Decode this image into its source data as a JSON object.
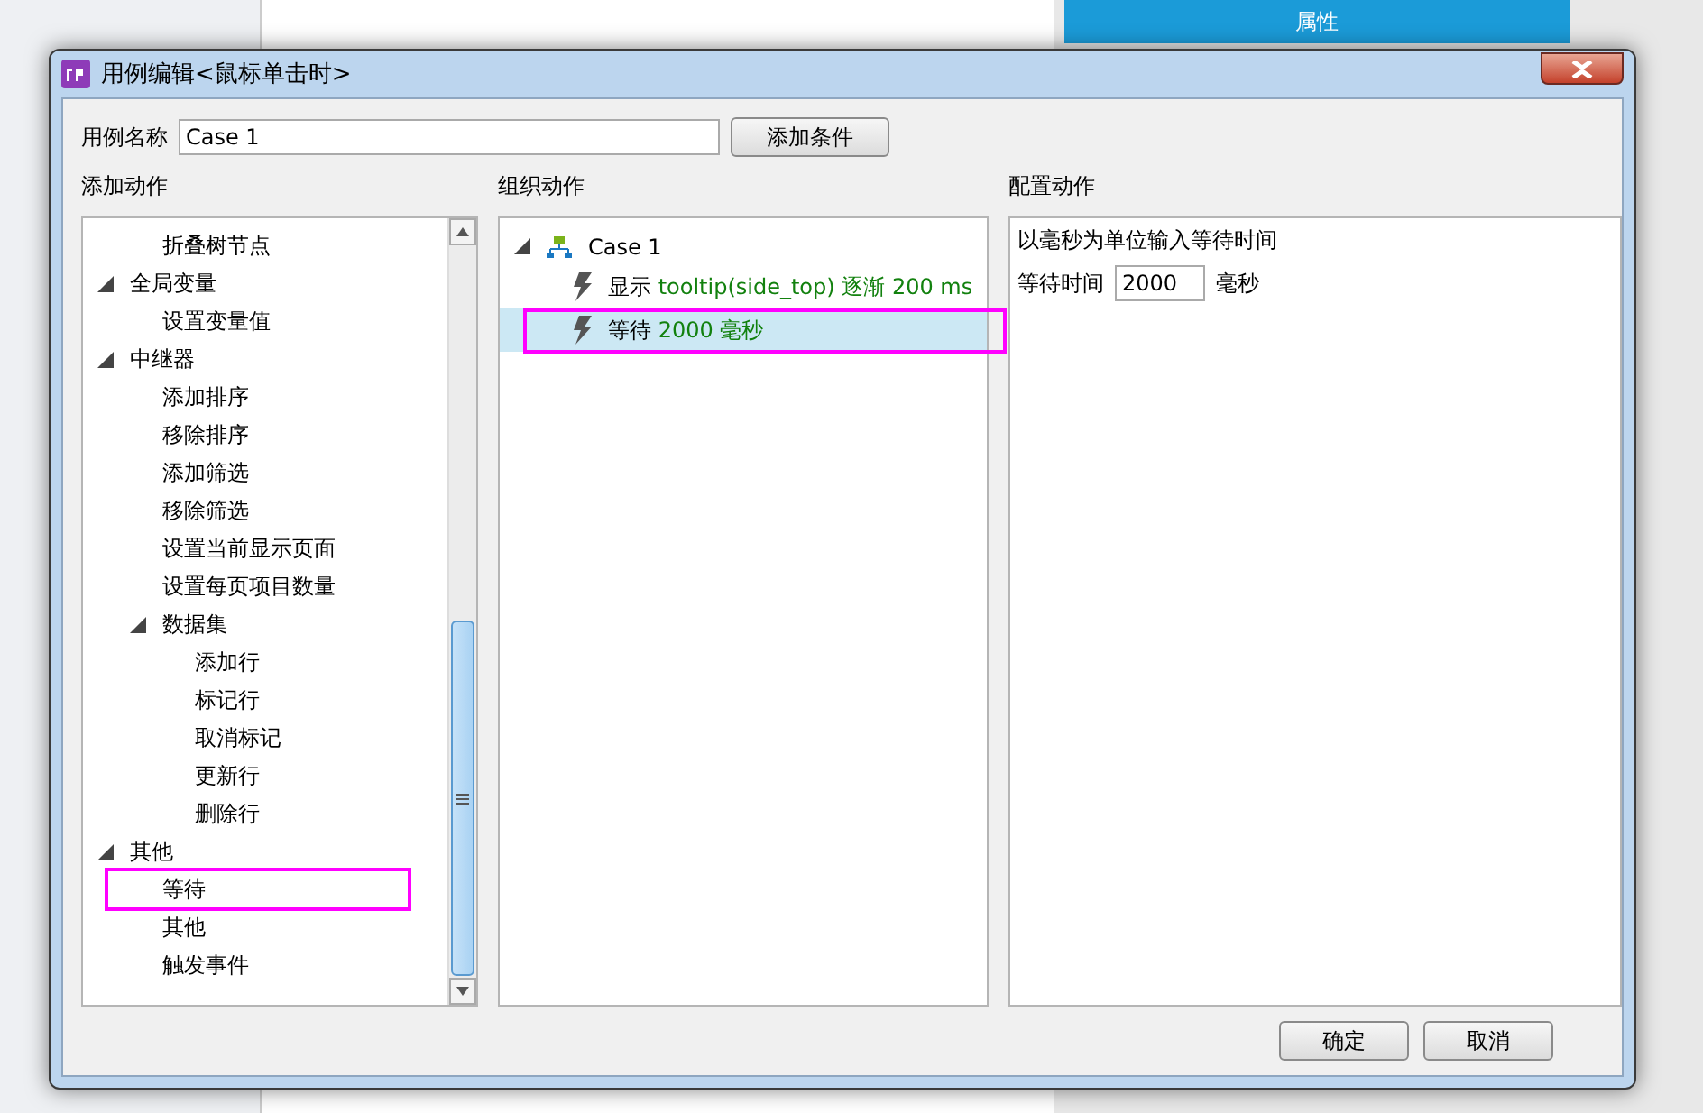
{
  "background": {
    "panel_tab": "属性"
  },
  "dialog": {
    "title": "用例编辑<鼠标单击时>",
    "case_name": {
      "label": "用例名称",
      "value": "Case 1"
    },
    "add_condition": "添加条件",
    "add_actions": {
      "heading": "添加动作",
      "tree": [
        {
          "children": [
            {
              "label": "折叠树节点",
              "highlighted": false
            }
          ]
        },
        {
          "label": "全局变量",
          "expanded": true,
          "children": [
            {
              "label": "设置变量值",
              "highlighted": false
            }
          ]
        },
        {
          "label": "中继器",
          "expanded": true,
          "children": [
            {
              "label": "添加排序",
              "highlighted": false
            },
            {
              "label": "移除排序",
              "highlighted": false
            },
            {
              "label": "添加筛选",
              "highlighted": false
            },
            {
              "label": "移除筛选",
              "highlighted": false
            },
            {
              "label": "设置当前显示页面",
              "highlighted": false
            },
            {
              "label": "设置每页项目数量",
              "highlighted": false
            },
            {
              "label": "数据集",
              "expanded": true,
              "children": [
                {
                  "label": "添加行",
                  "highlighted": false
                },
                {
                  "label": "标记行",
                  "highlighted": false
                },
                {
                  "label": "取消标记",
                  "highlighted": false
                },
                {
                  "label": "更新行",
                  "highlighted": false
                },
                {
                  "label": "删除行",
                  "highlighted": false
                }
              ]
            }
          ]
        },
        {
          "label": "其他",
          "expanded": true,
          "children": [
            {
              "label": "等待",
              "highlighted": true
            },
            {
              "label": "其他",
              "highlighted": false
            },
            {
              "label": "触发事件",
              "highlighted": false
            }
          ]
        }
      ]
    },
    "organize": {
      "heading": "组织动作",
      "case": {
        "label": "Case 1",
        "expanded": true
      },
      "actions": [
        {
          "verb": "显示",
          "detail": "tooltip(side_top) 逐渐 200 ms",
          "selected": false,
          "highlighted": false
        },
        {
          "verb": "等待",
          "detail": "2000 毫秒",
          "selected": true,
          "highlighted": true
        }
      ]
    },
    "configure": {
      "heading": "配置动作",
      "hint": "以毫秒为单位输入等待时间",
      "field_label": "等待时间",
      "value": "2000",
      "unit": "毫秒"
    },
    "buttons": [
      "确定",
      "取消"
    ]
  }
}
